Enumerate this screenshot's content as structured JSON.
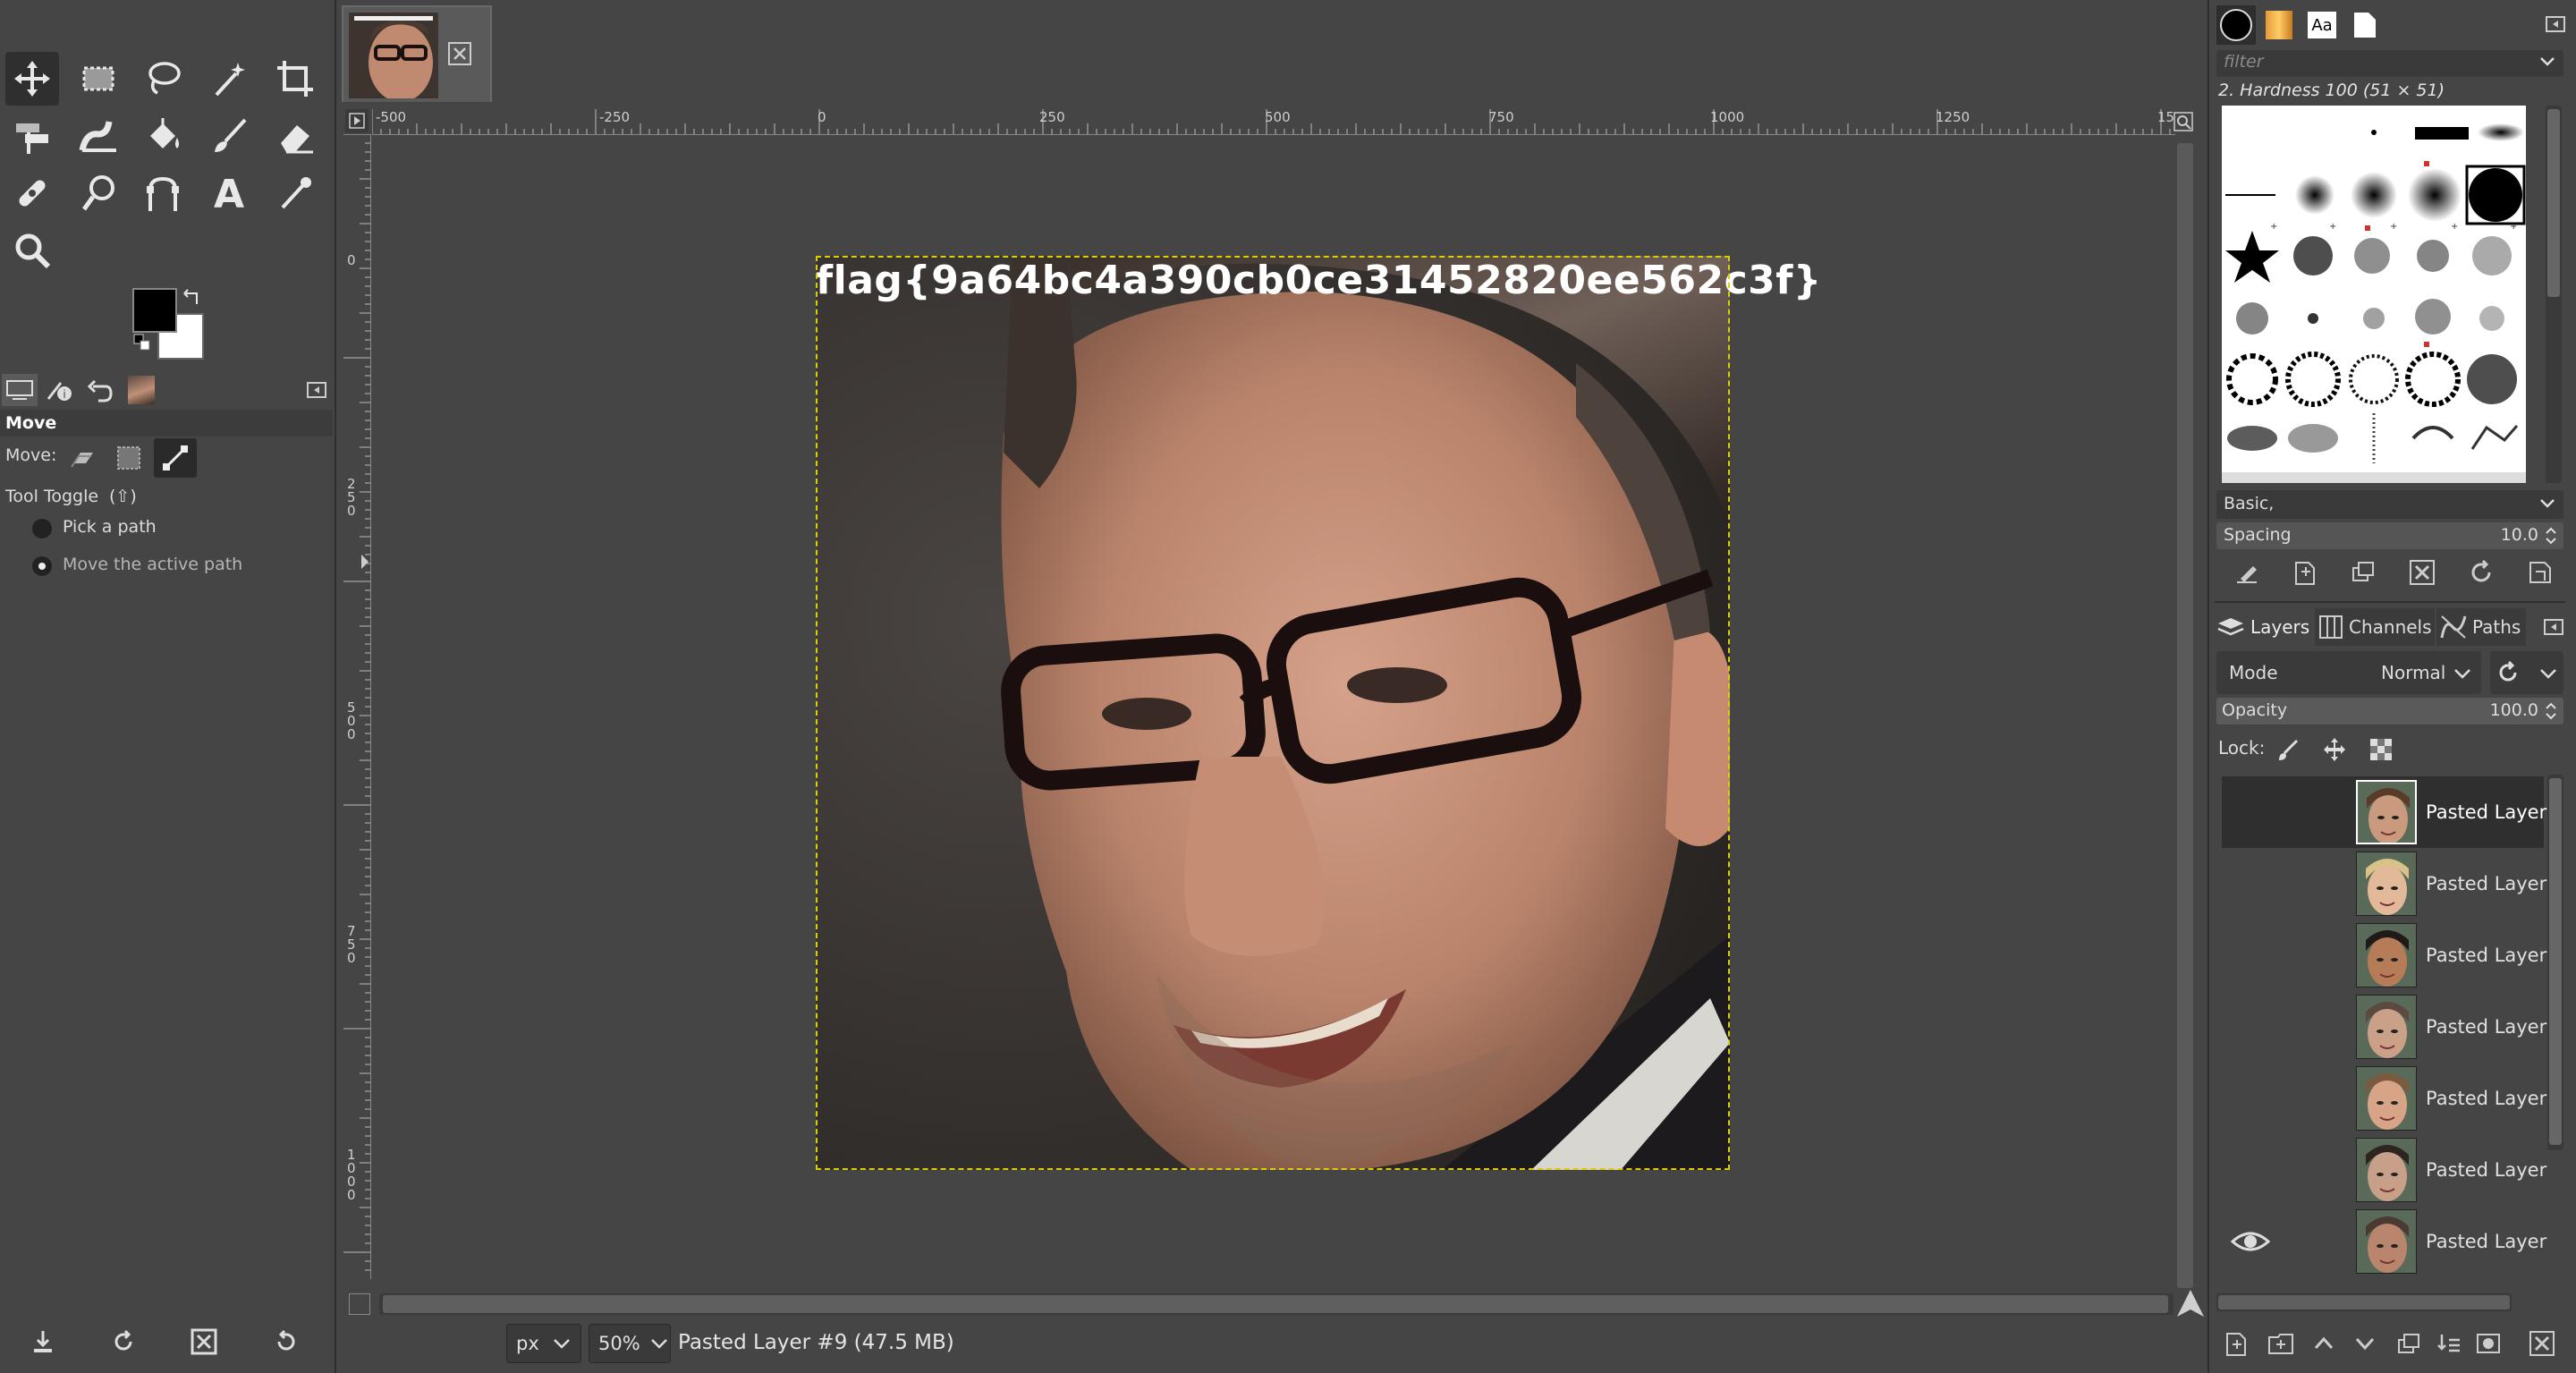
{
  "toolbox": {
    "tools": [
      "move-tool",
      "rect-select-tool",
      "free-select-tool",
      "fuzzy-select-tool",
      "crop-tool",
      "unified-transform-tool",
      "warp-transform-tool",
      "bucket-fill-tool",
      "paintbrush-tool",
      "eraser-tool",
      "heal-tool",
      "smudge-tool",
      "paths-tool",
      "text-tool",
      "color-picker-tool",
      "zoom-tool"
    ],
    "active_tool": "move-tool"
  },
  "tool_options": {
    "title": "Move",
    "move_label": "Move:",
    "toggle_label": "Tool Toggle",
    "toggle_key": "(⇧)",
    "option_pick": "Pick a path",
    "option_move": "Move the active path"
  },
  "ruler": {
    "top_ticks": [
      "-500",
      "-250",
      "0",
      "250",
      "500",
      "750",
      "1000",
      "1250",
      "15"
    ],
    "left_ticks": [
      "0",
      "250",
      "500",
      "750",
      "1000"
    ]
  },
  "canvas": {
    "flag_text": "flag{9a64bc4a390cb0ce31452820ee562c3f}"
  },
  "statusbar": {
    "unit": "px",
    "zoom": "50%",
    "info": "Pasted Layer #9 (47.5 MB)"
  },
  "brushes": {
    "filter_placeholder": "filter",
    "selected_brush": "2. Hardness 100 (51 × 51)",
    "preset": "Basic,",
    "spacing_label": "Spacing",
    "spacing_value": "10.0"
  },
  "layers_panel": {
    "tabs": [
      "Layers",
      "Channels",
      "Paths"
    ],
    "mode_label": "Mode",
    "mode_value": "Normal",
    "opacity_label": "Opacity",
    "opacity_value": "100.0",
    "lock_label": "Lock:",
    "layers": [
      {
        "name": "Pasted Layer",
        "selected": true,
        "visible": false,
        "skin": "#c99a7e",
        "hair": "#5a3a28"
      },
      {
        "name": "Pasted Layer",
        "selected": false,
        "visible": false,
        "skin": "#e2b999",
        "hair": "#d8c28a"
      },
      {
        "name": "Pasted Layer",
        "selected": false,
        "visible": false,
        "skin": "#b67c57",
        "hair": "#1f1a18"
      },
      {
        "name": "Pasted Layer",
        "selected": false,
        "visible": false,
        "skin": "#caa089",
        "hair": "#5b4a40"
      },
      {
        "name": "Pasted Layer",
        "selected": false,
        "visible": false,
        "skin": "#d8a487",
        "hair": "#7a5b3e"
      },
      {
        "name": "Pasted Layer",
        "selected": false,
        "visible": false,
        "skin": "#c8a08a",
        "hair": "#2e2420"
      },
      {
        "name": "Pasted Layer",
        "selected": false,
        "visible": true,
        "skin": "#b9856c",
        "hair": "#4a3a32"
      }
    ]
  },
  "colors": {
    "selection_outline": "#d8d000",
    "panel_bg": "#454545",
    "text": "#dcdcdc"
  }
}
